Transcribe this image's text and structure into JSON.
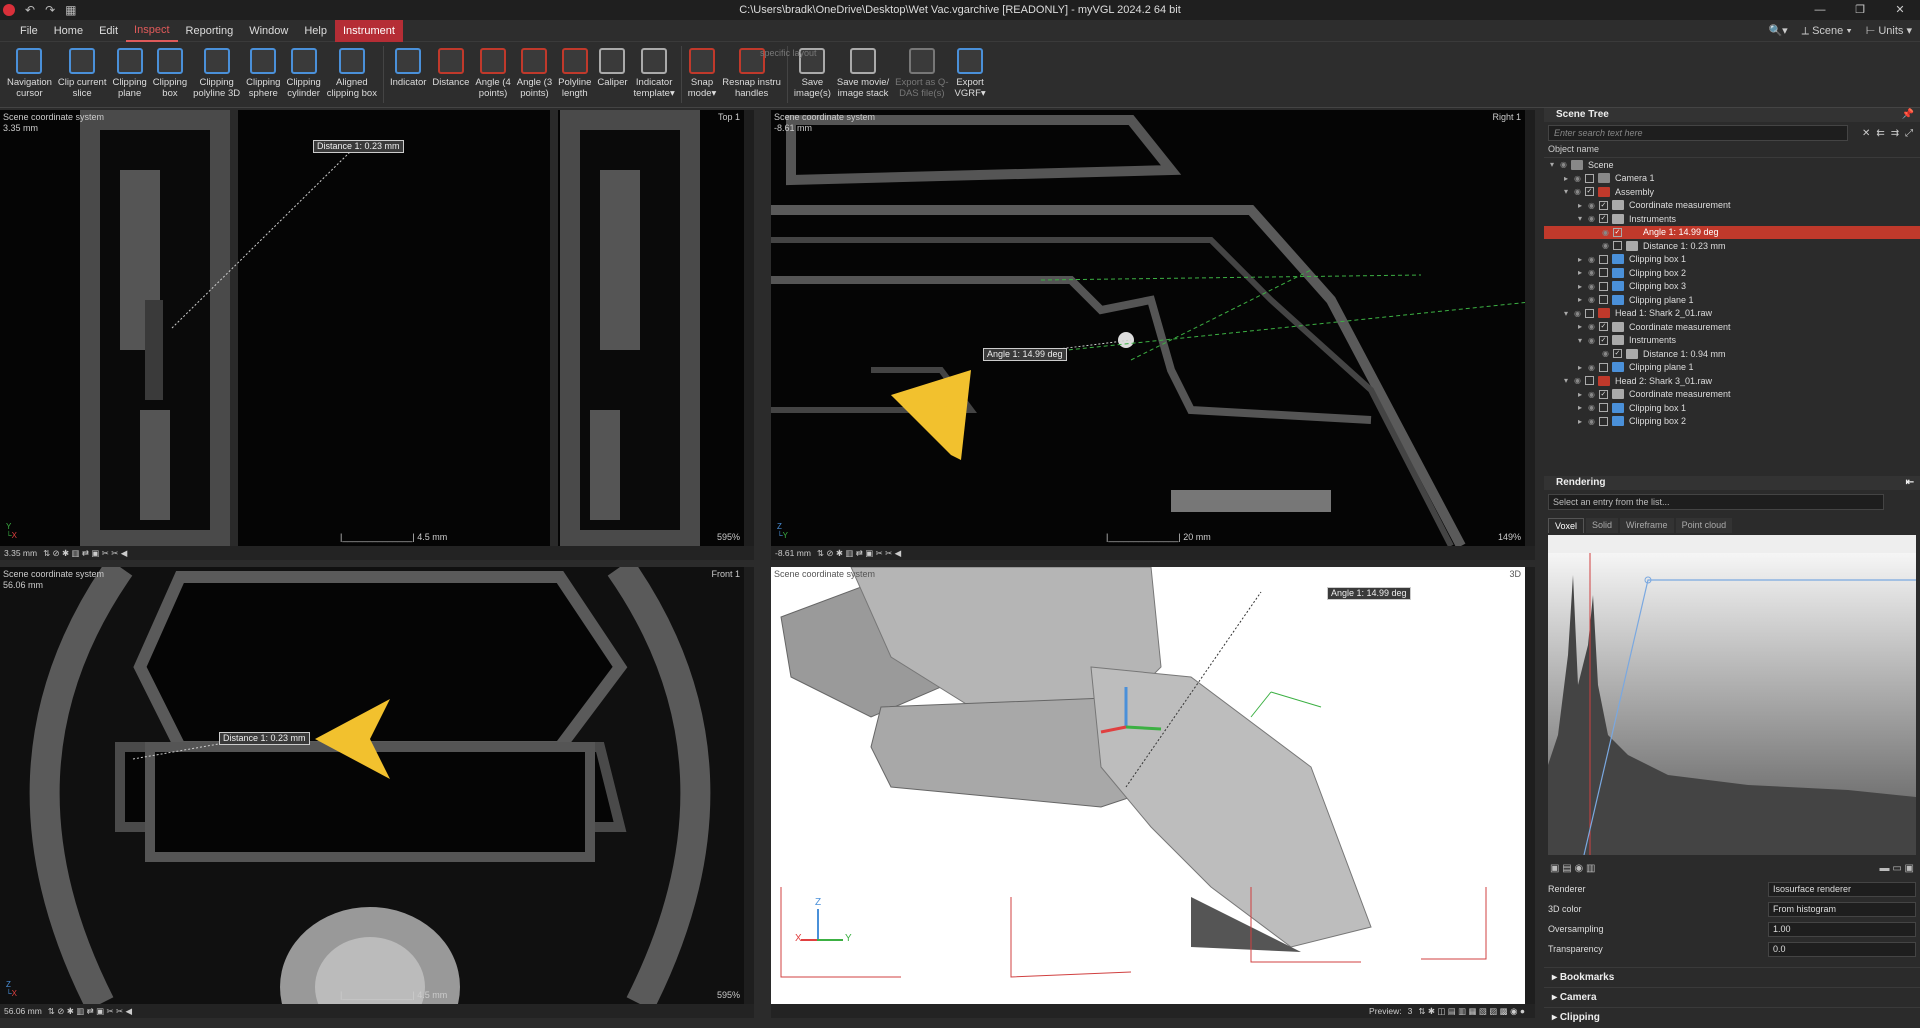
{
  "window": {
    "title": "C:\\Users\\bradk\\OneDrive\\Desktop\\Wet Vac.vgarchive [READONLY] - myVGL 2024.2 64 bit",
    "controls": [
      "—",
      "❐",
      "✕"
    ]
  },
  "menu": {
    "items": [
      "File",
      "Home",
      "Edit",
      "Inspect",
      "Reporting",
      "Window",
      "Help",
      "Instrument"
    ],
    "active": "Inspect",
    "right_items": [
      "Scene",
      "Units"
    ]
  },
  "ribbon": {
    "hint": "specific layout",
    "buttons": [
      {
        "label": "Navigation\ncursor",
        "icon": "cursor-icon",
        "color": "#4a90d9"
      },
      {
        "label": "Clip current\nslice",
        "icon": "clip-slice-icon",
        "color": "#4a90d9"
      },
      {
        "label": "Clipping\nplane",
        "icon": "clipping-plane-icon",
        "color": "#4a90d9"
      },
      {
        "label": "Clipping\nbox",
        "icon": "clipping-box-icon",
        "color": "#4a90d9"
      },
      {
        "label": "Clipping\npolyline 3D",
        "icon": "clipping-polyline-icon",
        "color": "#4a90d9"
      },
      {
        "label": "Clipping\nsphere",
        "icon": "clipping-sphere-icon",
        "color": "#4a90d9"
      },
      {
        "label": "Clipping\ncylinder",
        "icon": "clipping-cylinder-icon",
        "color": "#4a90d9"
      },
      {
        "label": "Aligned\nclipping box",
        "icon": "aligned-clipping-box-icon",
        "color": "#4a90d9"
      },
      {
        "label": "Indicator",
        "icon": "indicator-icon",
        "color": "#4a90d9"
      },
      {
        "label": "Distance",
        "icon": "distance-icon",
        "color": "#c0392b"
      },
      {
        "label": "Angle (4\npoints)",
        "icon": "angle4-icon",
        "color": "#c0392b"
      },
      {
        "label": "Angle (3\npoints)",
        "icon": "angle3-icon",
        "color": "#c0392b"
      },
      {
        "label": "Polyline\nlength",
        "icon": "polyline-icon",
        "color": "#c0392b"
      },
      {
        "label": "Caliper",
        "icon": "caliper-icon",
        "color": "#aaaaaa"
      },
      {
        "label": "Indicator\ntemplate▾",
        "icon": "indicator-template-icon",
        "color": "#aaaaaa"
      },
      {
        "label": "Snap\nmode▾",
        "icon": "snap-mode-icon",
        "color": "#c0392b"
      },
      {
        "label": "Resnap instru\nhandles",
        "icon": "resnap-icon",
        "color": "#c0392b"
      },
      {
        "label": "Save\nimage(s)",
        "icon": "save-image-icon",
        "color": "#aaaaaa"
      },
      {
        "label": "Save movie/\nimage stack",
        "icon": "save-movie-icon",
        "color": "#aaaaaa"
      },
      {
        "label": "Export as Q-\nDAS file(s)",
        "icon": "export-qdas-icon",
        "color": "#777777",
        "disabled": true
      },
      {
        "label": "Export\nVGRF▾",
        "icon": "export-vgrf-icon",
        "color": "#4a90d9"
      }
    ]
  },
  "viewports": {
    "top": {
      "coord": "Scene coordinate system",
      "depth": "3.35 mm",
      "name": "Top 1",
      "scale": "4.5 mm",
      "zoom": "595%",
      "status_value": "3.35 mm",
      "measurement": "Distance 1: 0.23 mm"
    },
    "right": {
      "coord": "Scene coordinate system",
      "depth": "-8.61 mm",
      "name": "Right 1",
      "scale": "20 mm",
      "zoom": "149%",
      "status_value": "-8.61 mm",
      "measurement": "Angle 1: 14.99 deg"
    },
    "front": {
      "coord": "Scene coordinate system",
      "depth": "56.06 mm",
      "name": "Front 1",
      "scale": "4.5 mm",
      "zoom": "595%",
      "status_value": "56.06 mm",
      "measurement": "Distance 1: 0.23 mm"
    },
    "3d": {
      "coord": "Scene coordinate system",
      "name": "3D",
      "measurement": "Angle 1: 14.99 deg",
      "preview_label": "Preview:",
      "preview_value": "3"
    }
  },
  "axes": {
    "x": "X",
    "y": "Y",
    "z": "Z"
  },
  "scene_tree": {
    "title": "Scene Tree",
    "search_placeholder": "Enter search text here",
    "column": "Object name",
    "rows": [
      {
        "label": "Scene",
        "indent": 0,
        "icon": "scene-icon",
        "color": "#888888"
      },
      {
        "label": "Camera 1",
        "indent": 1,
        "icon": "camera-icon",
        "color": "#888888"
      },
      {
        "label": "Assembly",
        "indent": 1,
        "icon": "assembly-icon",
        "color": "#c0392b",
        "checked": true
      },
      {
        "label": "Coordinate measurement",
        "indent": 2,
        "icon": "coord-icon",
        "color": "#aaaaaa",
        "checked": true
      },
      {
        "label": "Instruments",
        "indent": 2,
        "icon": "instruments-icon",
        "color": "#aaaaaa",
        "checked": true
      },
      {
        "label": "Angle 1: 14.99 deg",
        "indent": 3,
        "icon": "angle-icon",
        "color": "#c0392b",
        "checked": true,
        "selected": true
      },
      {
        "label": "Distance 1: 0.23 mm",
        "indent": 3,
        "icon": "distance-icon",
        "color": "#aaaaaa"
      },
      {
        "label": "Clipping box 1",
        "indent": 2,
        "icon": "clipbox-icon",
        "color": "#4a90d9"
      },
      {
        "label": "Clipping box 2",
        "indent": 2,
        "icon": "clipbox-icon",
        "color": "#4a90d9"
      },
      {
        "label": "Clipping box 3",
        "indent": 2,
        "icon": "clipbox-icon",
        "color": "#4a90d9"
      },
      {
        "label": "Clipping plane 1",
        "indent": 2,
        "icon": "clipplane-icon",
        "color": "#4a90d9"
      },
      {
        "label": "Head 1: Shark 2_01.raw",
        "indent": 1,
        "icon": "volume-icon",
        "color": "#c0392b"
      },
      {
        "label": "Coordinate measurement",
        "indent": 2,
        "icon": "coord-icon",
        "color": "#aaaaaa",
        "checked": true
      },
      {
        "label": "Instruments",
        "indent": 2,
        "icon": "instruments-icon",
        "color": "#aaaaaa",
        "checked": true
      },
      {
        "label": "Distance 1: 0.94 mm",
        "indent": 3,
        "icon": "distance-icon",
        "color": "#aaaaaa",
        "checked": true
      },
      {
        "label": "Clipping plane 1",
        "indent": 2,
        "icon": "clipplane-icon",
        "color": "#4a90d9"
      },
      {
        "label": "Head 2: Shark 3_01.raw",
        "indent": 1,
        "icon": "volume-icon",
        "color": "#c0392b"
      },
      {
        "label": "Coordinate measurement",
        "indent": 2,
        "icon": "coord-icon",
        "color": "#aaaaaa",
        "checked": true
      },
      {
        "label": "Clipping box 1",
        "indent": 2,
        "icon": "clipbox-icon",
        "color": "#4a90d9"
      },
      {
        "label": "Clipping box 2",
        "indent": 2,
        "icon": "clipbox-icon",
        "color": "#4a90d9"
      }
    ]
  },
  "rendering": {
    "title": "Rendering",
    "select_placeholder": "Select an entry from the list...",
    "tabs": [
      "Voxel",
      "Solid",
      "Wireframe",
      "Point cloud"
    ],
    "active_tab": "Voxel",
    "props": [
      {
        "label": "Renderer",
        "value": "Isosurface renderer"
      },
      {
        "label": "3D color",
        "value": "From histogram"
      },
      {
        "label": "Oversampling",
        "value": "1.00"
      },
      {
        "label": "Transparency",
        "value": "0.0"
      }
    ],
    "sections": [
      "Bookmarks",
      "Camera",
      "Clipping"
    ]
  },
  "colors": {
    "accent": "#c0392b",
    "marker": "#f2c12e",
    "measure_green": "#3cb043"
  }
}
